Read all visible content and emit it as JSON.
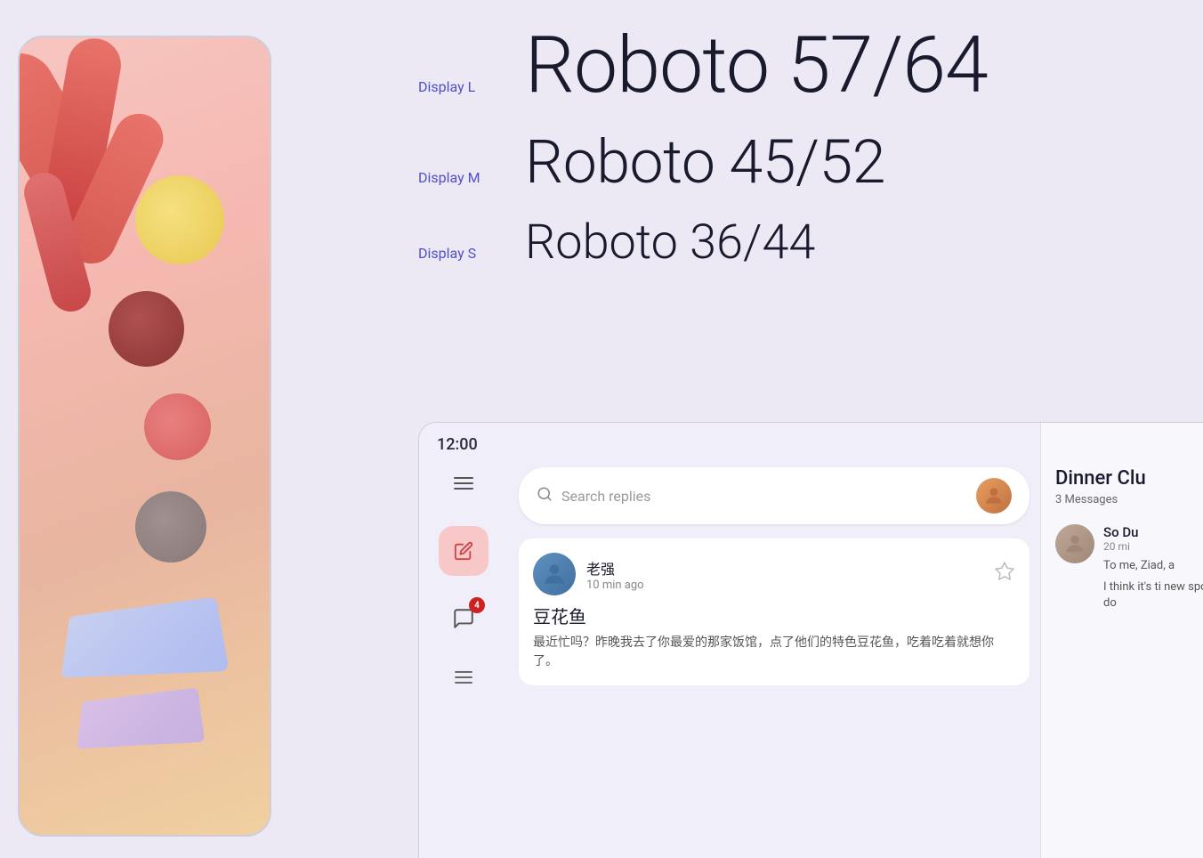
{
  "left_panel": {
    "phone_visible": true
  },
  "typography": {
    "display_l": {
      "label": "Display L",
      "text": "Roboto 57/64"
    },
    "display_m": {
      "label": "Display M",
      "text": "Roboto 45/52"
    },
    "display_s": {
      "label": "Display S",
      "text": "Roboto 36/44"
    }
  },
  "ui_mockup": {
    "time": "12:00",
    "search_placeholder": "Search replies",
    "chat": {
      "sender_name": "老强",
      "time_ago": "10 min ago",
      "subject": "豆花鱼",
      "preview": "最近忙吗？昨晚我去了你最爱的那家饭馆，点了他们的特色豆花鱼，吃着吃着就想你了。"
    },
    "dinner_club": {
      "title": "Dinner Clu",
      "message_count": "3 Messages",
      "person": {
        "name": "So Du",
        "time_ago": "20 mi",
        "message": "To me, Ziad, a",
        "secondary_message": "I think it's ti new spot do"
      }
    },
    "sidebar": {
      "badge_count": "4"
    }
  }
}
